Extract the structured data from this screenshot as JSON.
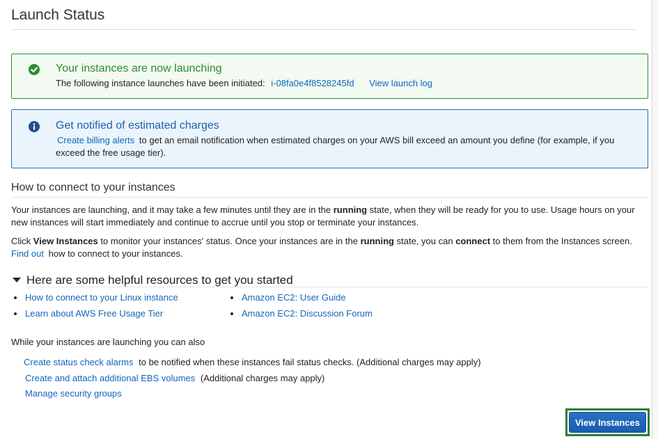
{
  "page": {
    "title": "Launch Status"
  },
  "success_alert": {
    "title": "Your instances are now launching",
    "text": "The following instance launches have been initiated:",
    "instance_id": "i-08fa0e4f8528245fd",
    "log_link": "View launch log",
    "icon": "check-circle-icon",
    "color": "#2e8b2e"
  },
  "info_alert": {
    "title": "Get notified of estimated charges",
    "link": "Create billing alerts",
    "text": "to get an email notification when estimated charges on your AWS bill exceed an amount you define (for example, if you exceed the free usage tier).",
    "icon": "info-circle-icon",
    "color": "#1f5fa8"
  },
  "connect": {
    "heading": "How to connect to your instances",
    "p1": {
      "before": "Your instances are launching, and it may take a few minutes until they are in the",
      "bold": "running",
      "after": "state, when they will be ready for you to use. Usage hours on your new instances will start immediately and continue to accrue until you stop or terminate your instances."
    },
    "p2": {
      "click": "Click",
      "bold1": "View Instances",
      "mid1": "to monitor your instances' status. Once your instances are in the",
      "bold2": "running",
      "mid2": "state, you can",
      "bold3": "connect",
      "mid3": "to them from the Instances screen.",
      "link": "Find out",
      "end": "how to connect to your instances."
    }
  },
  "resources": {
    "title": "Here are some helpful resources to get you started",
    "col1": [
      "How to connect to your Linux instance",
      "Learn about AWS Free Usage Tier"
    ],
    "col2": [
      "Amazon EC2: User Guide",
      "Amazon EC2: Discussion Forum"
    ]
  },
  "also": {
    "heading": "While your instances are launching you can also",
    "actions": [
      {
        "link": "Create status check alarms",
        "text": "to be notified when these instances fail status checks. (Additional charges may apply)"
      },
      {
        "link": "Create and attach additional EBS volumes",
        "text": "(Additional charges may apply)"
      },
      {
        "link": "Manage security groups",
        "text": ""
      }
    ]
  },
  "footer": {
    "view_instances_label": "View Instances",
    "highlight_color": "#2e7d32",
    "button_color": "#1a5cae"
  }
}
